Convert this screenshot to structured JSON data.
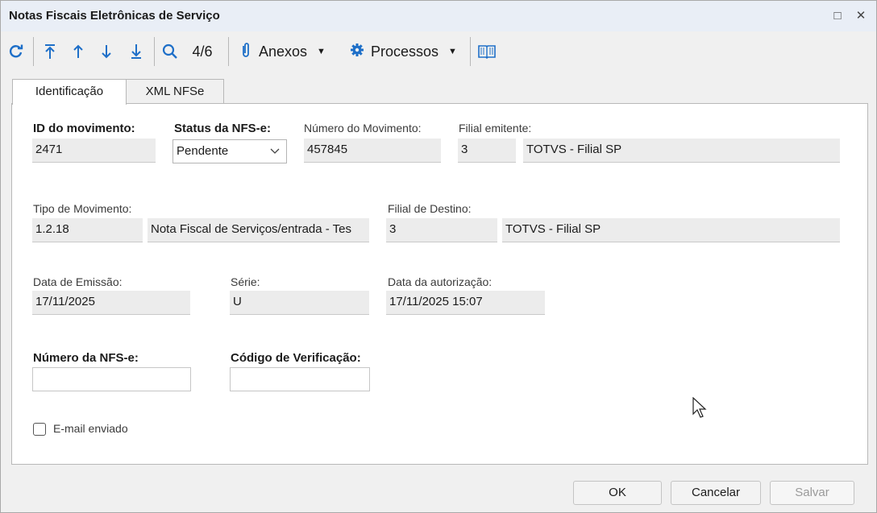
{
  "window": {
    "title": "Notas Fiscais Eletrônicas de Serviço",
    "maximize_icon": "□",
    "close_icon": "✕"
  },
  "toolbar": {
    "record_position": "4/6",
    "attachments_label": "Anexos",
    "processes_label": "Processos"
  },
  "tabs": [
    {
      "label": "Identificação",
      "active": true
    },
    {
      "label": "XML NFSe",
      "active": false
    }
  ],
  "form": {
    "id_movimento": {
      "label": "ID do movimento:",
      "value": "2471"
    },
    "status_nfse": {
      "label": "Status da NFS-e:",
      "value": "Pendente"
    },
    "numero_movimento": {
      "label": "Número do Movimento:",
      "value": "457845"
    },
    "filial_emitente": {
      "label": "Filial emitente:",
      "code": "3",
      "name": "TOTVS - Filial SP"
    },
    "tipo_movimento": {
      "label": "Tipo de Movimento:",
      "code": "1.2.18",
      "name": "Nota Fiscal de Serviços/entrada - Tes"
    },
    "filial_destino": {
      "label": "Filial de Destino:",
      "code": "3",
      "name": "TOTVS - Filial SP"
    },
    "data_emissao": {
      "label": "Data de Emissão:",
      "value": "17/11/2025"
    },
    "serie": {
      "label": "Série:",
      "value": "U"
    },
    "data_autorizacao": {
      "label": "Data da autorização:",
      "value": "17/11/2025 15:07"
    },
    "numero_nfse": {
      "label": "Número da NFS-e:",
      "value": ""
    },
    "codigo_verificacao": {
      "label": "Código de Verificação:",
      "value": ""
    },
    "email_enviado": {
      "label": "E-mail enviado",
      "checked": false
    }
  },
  "buttons": {
    "ok": "OK",
    "cancel": "Cancelar",
    "save": "Salvar"
  }
}
